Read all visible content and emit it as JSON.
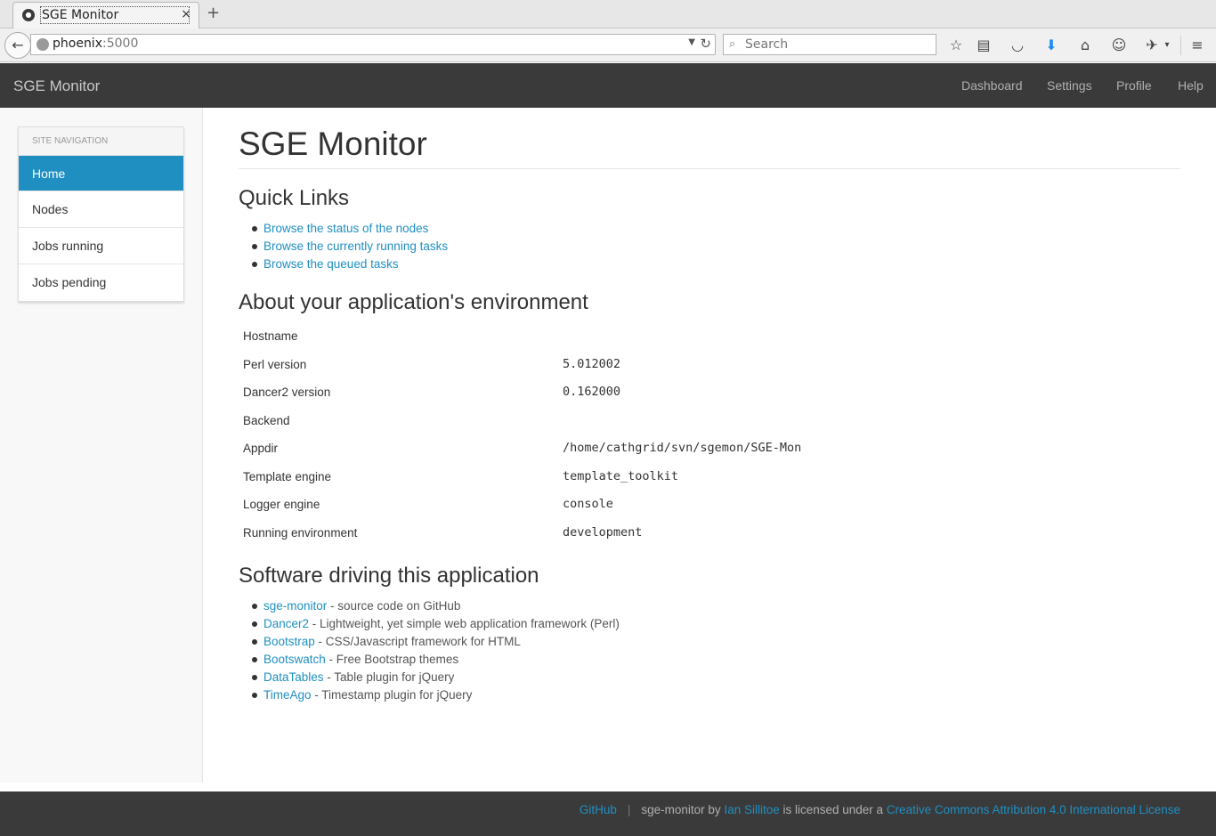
{
  "browser": {
    "tab_title": "SGE Monitor",
    "tab_close": "×",
    "new_tab": "+",
    "url_host": "phoenix",
    "url_port": ":5000",
    "search_placeholder": "Search"
  },
  "app_navbar": {
    "brand": "SGE Monitor",
    "links": [
      {
        "label": "Dashboard"
      },
      {
        "label": "Settings"
      },
      {
        "label": "Profile"
      },
      {
        "label": "Help"
      }
    ]
  },
  "sidebar": {
    "heading": "SITE NAVIGATION",
    "items": [
      {
        "label": "Home",
        "active": true
      },
      {
        "label": "Nodes"
      },
      {
        "label": "Jobs running"
      },
      {
        "label": "Jobs pending"
      }
    ]
  },
  "main": {
    "title": "SGE Monitor",
    "quick_links": {
      "heading": "Quick Links",
      "items": [
        "Browse the status of the nodes",
        "Browse the currently running tasks",
        "Browse the queued tasks"
      ]
    },
    "environment": {
      "heading": "About your application's environment",
      "rows": [
        {
          "key": "Hostname",
          "value": ""
        },
        {
          "key": "Perl version",
          "value": "5.012002"
        },
        {
          "key": "Dancer2 version",
          "value": "0.162000"
        },
        {
          "key": "Backend",
          "value": ""
        },
        {
          "key": "Appdir",
          "value": "/home/cathgrid/svn/sgemon/SGE-Mon"
        },
        {
          "key": "Template engine",
          "value": "template_toolkit"
        },
        {
          "key": "Logger engine",
          "value": "console"
        },
        {
          "key": "Running environment",
          "value": "development"
        }
      ]
    },
    "software": {
      "heading": "Software driving this application",
      "items": [
        {
          "name": "sge-monitor",
          "desc": " - source code on GitHub"
        },
        {
          "name": "Dancer2",
          "desc": " - Lightweight, yet simple web application framework (Perl)"
        },
        {
          "name": "Bootstrap",
          "desc": " - CSS/Javascript framework for HTML"
        },
        {
          "name": "Bootswatch",
          "desc": " - Free Bootstrap themes"
        },
        {
          "name": "DataTables",
          "desc": " - Table plugin for jQuery"
        },
        {
          "name": "TimeAgo",
          "desc": " - Timestamp plugin for jQuery"
        }
      ]
    }
  },
  "footer": {
    "github": "GitHub",
    "sep": "|",
    "text1": "sge-monitor by ",
    "author": "Ian Sillitoe",
    "text2": " is licensed under a ",
    "license": "Creative Commons Attribution 4.0 International License"
  },
  "colors": {
    "accent": "#1f8fc2",
    "navbar": "#3a3a3a"
  }
}
